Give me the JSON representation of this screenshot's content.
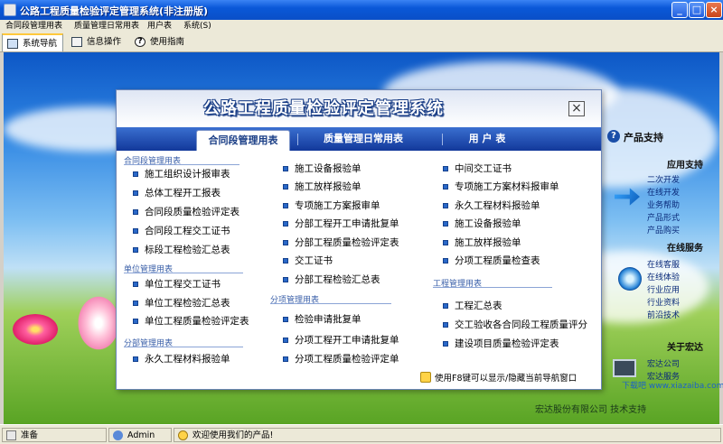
{
  "window": {
    "title": "公路工程质量检验评定管理系统(非注册版)",
    "buttons": {
      "minimize": "_",
      "maximize": "□",
      "close": "×"
    }
  },
  "menubar": [
    "合同段管理用表",
    "质量管理日常用表",
    "用户表",
    "系统(S)"
  ],
  "toolbar_tabs": [
    {
      "label": "系统导航",
      "icon": "monitor-icon",
      "active": true
    },
    {
      "label": "信息操作",
      "icon": "notebook-icon",
      "active": false
    },
    {
      "label": "使用指南",
      "icon": "help-icon",
      "active": false
    }
  ],
  "right_panel": {
    "product_support": "产品支持",
    "sections": [
      {
        "title": "应用支持",
        "links": [
          "二次开发",
          "在线开发",
          "业务帮助",
          "产品形式",
          "产品购买"
        ]
      },
      {
        "title": "在线服务",
        "links": [
          "在线客服",
          "在线体验",
          "行业应用",
          "行业资料",
          "前沿技术"
        ]
      },
      {
        "title": "关于宏达",
        "links": [
          "宏达公司",
          "宏达服务"
        ]
      }
    ]
  },
  "dialog": {
    "title": "公路工程质量检验评定管理系统",
    "close": "×",
    "tabs": [
      "合同段管理用表",
      "质量管理日常用表",
      "用 户 表"
    ],
    "active_tab": 0,
    "col1": {
      "sections": [
        {
          "title": "合同段管理用表",
          "items": [
            "施工组织设计报审表",
            "总体工程开工报表",
            "合同段质量检验评定表",
            "合同段工程交工证书",
            "标段工程检验汇总表"
          ]
        },
        {
          "title": "单位管理用表",
          "items": [
            "单位工程交工证书",
            "单位工程检验汇总表",
            "单位工程质量检验评定表"
          ]
        },
        {
          "title": "分部管理用表",
          "items": [
            "永久工程材料报验单"
          ]
        }
      ]
    },
    "col2": {
      "items_top": [
        "施工设备报验单",
        "施工放样报验单",
        "专项施工方案报审单",
        "分部工程开工申请批复单",
        "分部工程质量检验评定表",
        "交工证书",
        "分部工程检验汇总表"
      ],
      "section": {
        "title": "分项管理用表",
        "items": [
          "检验申请批复单",
          "分项工程开工申请批复单",
          "分项工程质量检验评定单"
        ]
      }
    },
    "col3": {
      "items_top": [
        "中间交工证书",
        "专项施工方案材料报审单",
        "永久工程材料报验单",
        "施工设备报验单",
        "施工放样报验单",
        "分项工程质量检查表"
      ],
      "section": {
        "title": "工程管理用表",
        "items": [
          "工程汇总表",
          "交工验收各合同段工程质量评分",
          "建设项目质量检验评定表"
        ]
      }
    },
    "status_hint": "使用F8键可以显示/隐藏当前导航窗口"
  },
  "background_text": "宏达股份有限公司  技术支持",
  "watermark": "下载吧 www.xiazaiba.com",
  "statusbar": {
    "status": "准备",
    "user": "Admin",
    "welcome": "欢迎使用我们的产品!"
  },
  "colors": {
    "titlebar": "#0a58d8",
    "dialog_tab": "#12389a",
    "bullet": "#2a68c8",
    "section_title": "#3a5fa8"
  }
}
